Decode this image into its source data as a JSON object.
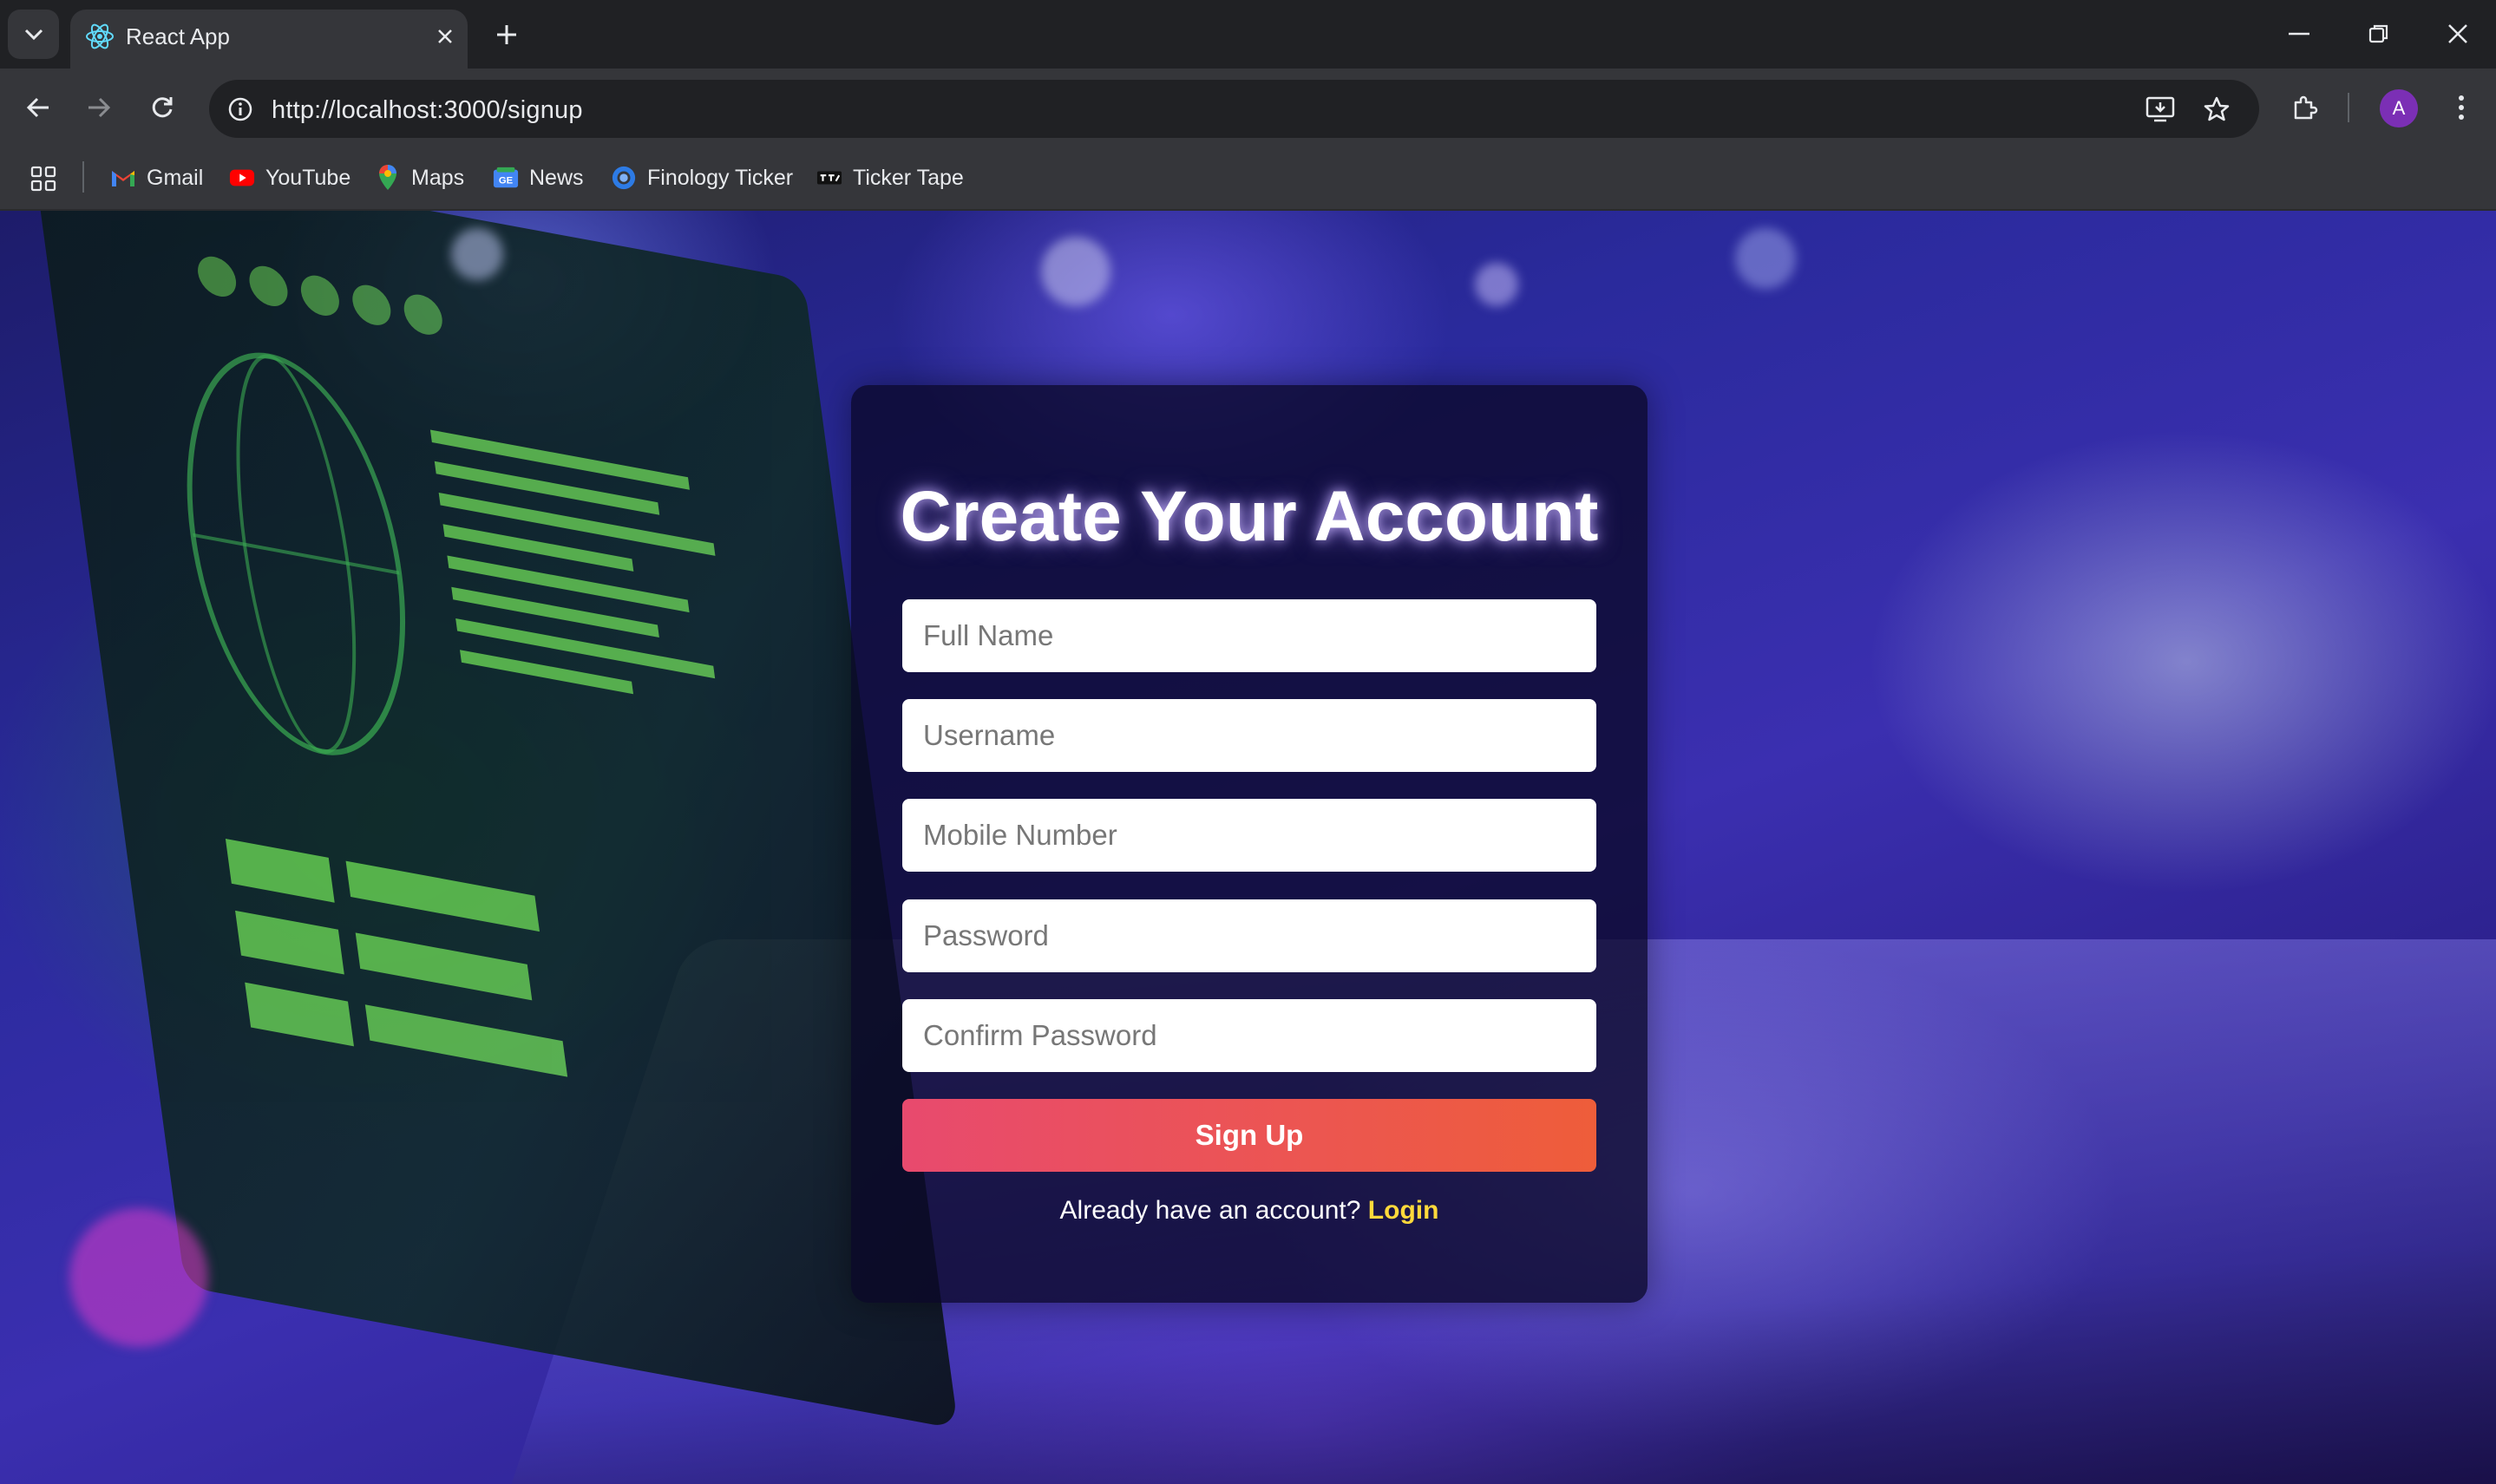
{
  "browser": {
    "tab_title": "React App",
    "url": "http://localhost:3000/signup",
    "avatar_letter": "A",
    "bookmarks": [
      {
        "label": "Gmail",
        "icon": "gmail-icon"
      },
      {
        "label": "YouTube",
        "icon": "youtube-icon"
      },
      {
        "label": "Maps",
        "icon": "maps-icon"
      },
      {
        "label": "News",
        "icon": "news-icon"
      },
      {
        "label": "Finology Ticker",
        "icon": "finology-icon"
      },
      {
        "label": "Ticker Tape",
        "icon": "tickertape-icon"
      }
    ]
  },
  "signup": {
    "title": "Create Your Account",
    "fields": {
      "full_name": "Full Name",
      "username": "Username",
      "mobile": "Mobile Number",
      "password": "Password",
      "confirm_password": "Confirm Password"
    },
    "submit_label": "Sign Up",
    "login_prompt": "Already have an account?",
    "login_link": "Login"
  },
  "colors": {
    "button_gradient_start": "#e84a6e",
    "button_gradient_end": "#ee5d3a",
    "login_link": "#ffd93b",
    "card_bg": "#0a0828"
  }
}
